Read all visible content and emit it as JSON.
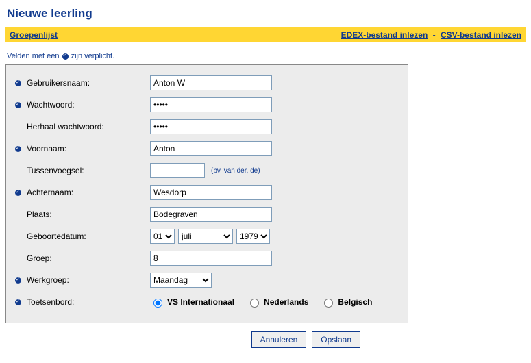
{
  "page_title": "Nieuwe leerling",
  "topbar": {
    "left_link": "Groepenlijst",
    "right_link_1": "EDEX-bestand inlezen",
    "separator": "-",
    "right_link_2": "CSV-bestand inlezen"
  },
  "required_note": {
    "prefix": "Velden met een ",
    "suffix": " zijn verplicht."
  },
  "form": {
    "gebruikersnaam": {
      "label": "Gebruikersnaam:",
      "value": "Anton W",
      "required": true
    },
    "wachtwoord": {
      "label": "Wachtwoord:",
      "value": "•••••",
      "required": true
    },
    "herhaal": {
      "label": "Herhaal wachtwoord:",
      "value": "•••••",
      "required": false
    },
    "voornaam": {
      "label": "Voornaam:",
      "value": "Anton",
      "required": true
    },
    "tussenvoegsel": {
      "label": "Tussenvoegsel:",
      "value": "",
      "hint": "(bv. van der, de)",
      "required": false
    },
    "achternaam": {
      "label": "Achternaam:",
      "value": "Wesdorp",
      "required": true
    },
    "plaats": {
      "label": "Plaats:",
      "value": "Bodegraven",
      "required": false
    },
    "geboortedatum": {
      "label": "Geboortedatum:",
      "day": "01",
      "month": "juli",
      "year": "1979",
      "required": false
    },
    "groep": {
      "label": "Groep:",
      "value": "8",
      "required": false
    },
    "werkgroep": {
      "label": "Werkgroep:",
      "value": "Maandag",
      "required": true
    },
    "toetsenbord": {
      "label": "Toetsenbord:",
      "required": true,
      "options": [
        {
          "label": "VS Internationaal",
          "checked": true
        },
        {
          "label": "Nederlands",
          "checked": false
        },
        {
          "label": "Belgisch",
          "checked": false
        }
      ]
    }
  },
  "buttons": {
    "cancel": "Annuleren",
    "save": "Opslaan"
  }
}
